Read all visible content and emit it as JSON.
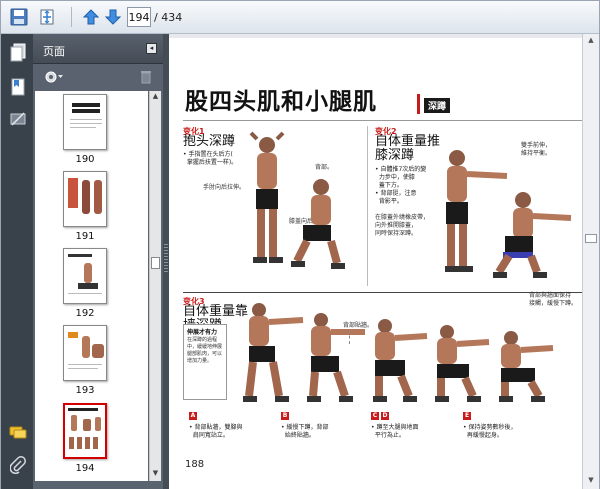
{
  "toolbar": {
    "current_page": "194",
    "total_pages": "/ 434"
  },
  "panel": {
    "title": "页面",
    "collapse_glyph": "◂"
  },
  "thumbnails": [
    {
      "label": "190",
      "selected": false
    },
    {
      "label": "191",
      "selected": false
    },
    {
      "label": "192",
      "selected": false
    },
    {
      "label": "193",
      "selected": false
    },
    {
      "label": "194",
      "selected": true
    }
  ],
  "page": {
    "title": "股四头肌和小腿肌",
    "tag": "深蹲",
    "page_number": "188",
    "variation1": {
      "label": "变化1",
      "name": "抱头深蹲"
    },
    "variation2": {
      "label": "变化2",
      "name_line1": "自体重量推",
      "name_line2": "膝深蹲"
    },
    "variation3": {
      "label": "变化3",
      "name_line1": "自体重量靠",
      "name_line2": "墙深蹲"
    },
    "sidebar_title": "伸展才有力",
    "step_labels": [
      "A",
      "B",
      "C",
      "D",
      "E"
    ]
  },
  "colors": {
    "accent_red": "#c91b1b",
    "rail_dark": "#39414b",
    "panel_gray": "#5a6370",
    "selection_red": "#d40000"
  },
  "icons": {
    "save": "save-icon",
    "fit": "fit-page-icon",
    "prev": "up-arrow-icon",
    "next": "down-arrow-icon",
    "pages": "pages-icon",
    "bookmarks": "bookmark-icon",
    "signatures": "signature-icon",
    "comments": "comment-icon",
    "attachments": "paperclip-icon",
    "options": "gear-icon",
    "delete": "trash-icon"
  }
}
